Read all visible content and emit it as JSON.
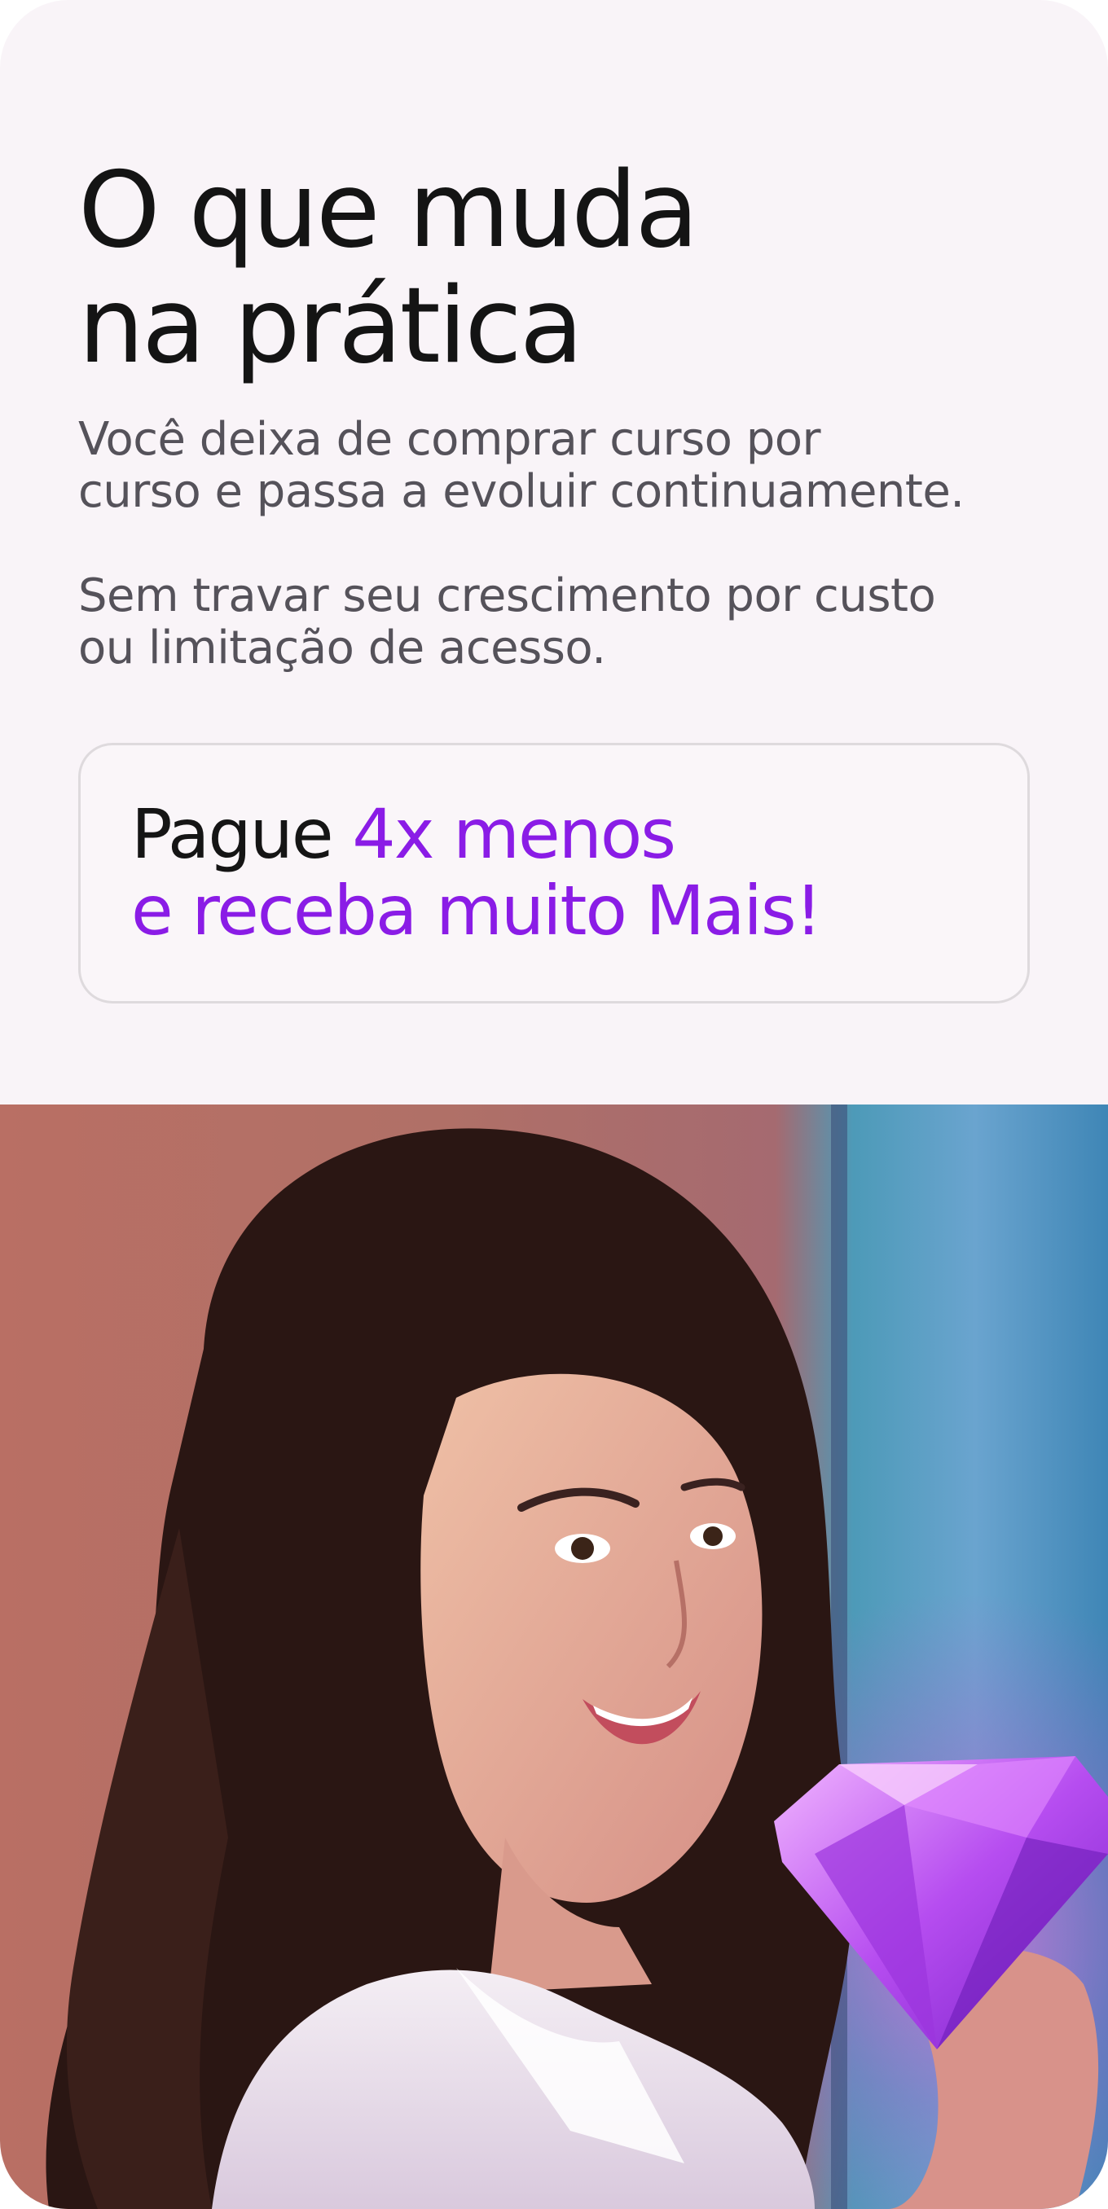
{
  "section": {
    "title_line1": "O que muda",
    "title_line2": "na prática",
    "paragraph1_line1": "Você deixa de comprar curso por",
    "paragraph1_line2": "curso e passa a evoluir continuamente.",
    "paragraph2_line1": "Sem travar seu crescimento por custo",
    "paragraph2_line2": "ou limitação de acesso."
  },
  "promo": {
    "part1": "Pague ",
    "part2": "4x menos",
    "line2": "e receba muito Mais!"
  },
  "colors": {
    "accent": "#8a1ce6",
    "card_background": "#f9f4f8",
    "heading": "#141414",
    "body_text": "#55525a"
  }
}
